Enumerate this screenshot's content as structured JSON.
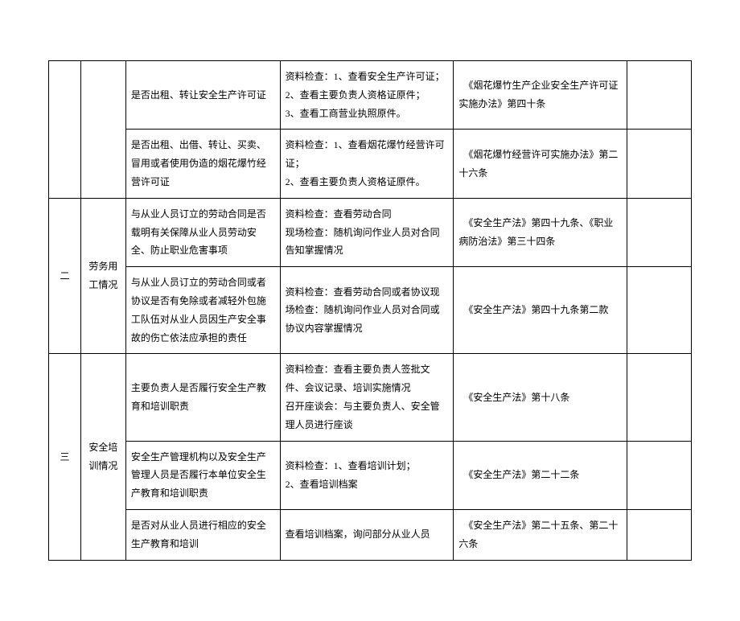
{
  "rows": [
    {
      "num": "",
      "cat": "",
      "item": "是否出租、转让安全生产许可证",
      "method": "资料检查：1、查看安全生产许可证；\n2、查看主要负责人资格证原件；\n3、查看工商营业执照原件。",
      "law": "　《烟花爆竹生产企业安全生产许可证实施办法》第四十条",
      "last": ""
    },
    {
      "item": "是否出租、出借、转让、买卖、冒用或者使用伪造的烟花爆竹经营许可证",
      "method": "资料检查：1、查看烟花爆竹经营许可证；\n2、查看主要负责人资格证原件。",
      "law": "　《烟花爆竹经营许可实施办法》第二十六条",
      "last": ""
    },
    {
      "num": "二",
      "cat": "劳务用工情况",
      "item": "与从业人员订立的劳动合同是否载明有关保障从业人员劳动安全、防止职业危害事项",
      "method": "资料检查：查看劳动合同\n现场检查：随机询问作业人员对合同告知掌握情况",
      "law": "　《安全生产法》第四十九条、《职业病防治法》第三十四条",
      "last": ""
    },
    {
      "item": "与从业人员订立的劳动合同或者协议是否有免除或者减轻外包施工队伍对从业人员因生产安全事故的伤亡依法应承担的责任",
      "method": "资料检查：查看劳动合同或者协议现场检查：随机询问作业人员对合同或协议内容掌握情况",
      "law": "　《安全生产法》第四十九条第二款",
      "last": ""
    },
    {
      "num": "三",
      "cat": "安全培训情况",
      "item": "主要负责人是否履行安全生产教育和培训职责",
      "method": "资料检查：查看主要负责人签批文件、会议记录、培训实施情况\n召开座谈会：与主要负责人、安全管理人员进行座谈",
      "law": "　《安全生产法》第十八条",
      "last": ""
    },
    {
      "item": "安全生产管理机构以及安全生产管理人员是否履行本单位安全生产教育和培训职责",
      "method": "资料检查：1、查看培训计划；\n2、查看培训档案",
      "law": "　《安全生产法》第二十二条",
      "last": ""
    },
    {
      "item": "是否对从业人员进行相应的安全生产教育和培训",
      "method": "查看培训档案，询问部分从业人员",
      "law": "　《安全生产法》第二十五条、第二十六条",
      "last": ""
    }
  ]
}
